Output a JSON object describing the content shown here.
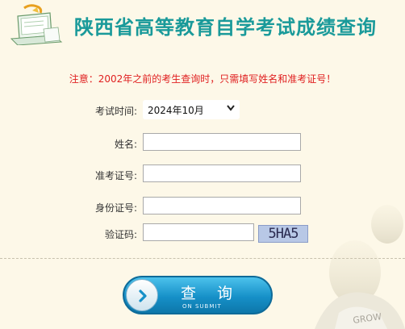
{
  "header": {
    "title": "陕西省高等教育自学考试成绩查询"
  },
  "notice": "注意：2002年之前的考生查询时，只需填写姓名和准考证号！",
  "form": {
    "exam_time_label": "考试时间:",
    "exam_time_value": "2024年10月",
    "name_label": "姓名:",
    "name_value": "",
    "ticket_label": "准考证号:",
    "ticket_value": "",
    "idcard_label": "身份证号:",
    "idcard_value": "",
    "captcha_label": "验证码:",
    "captcha_value": "",
    "captcha_image_text": "5HA5"
  },
  "submit": {
    "label": "查 询",
    "sub_label": "ON SUBMIT"
  },
  "colors": {
    "background": "#fdf8e8",
    "title": "#1a9a9a",
    "notice": "#e02020",
    "button": "#1690c8"
  },
  "icons": {
    "logo": "laptop-book-icon",
    "button": "chevron-right-icon",
    "dropdown": "chevron-down-icon"
  }
}
